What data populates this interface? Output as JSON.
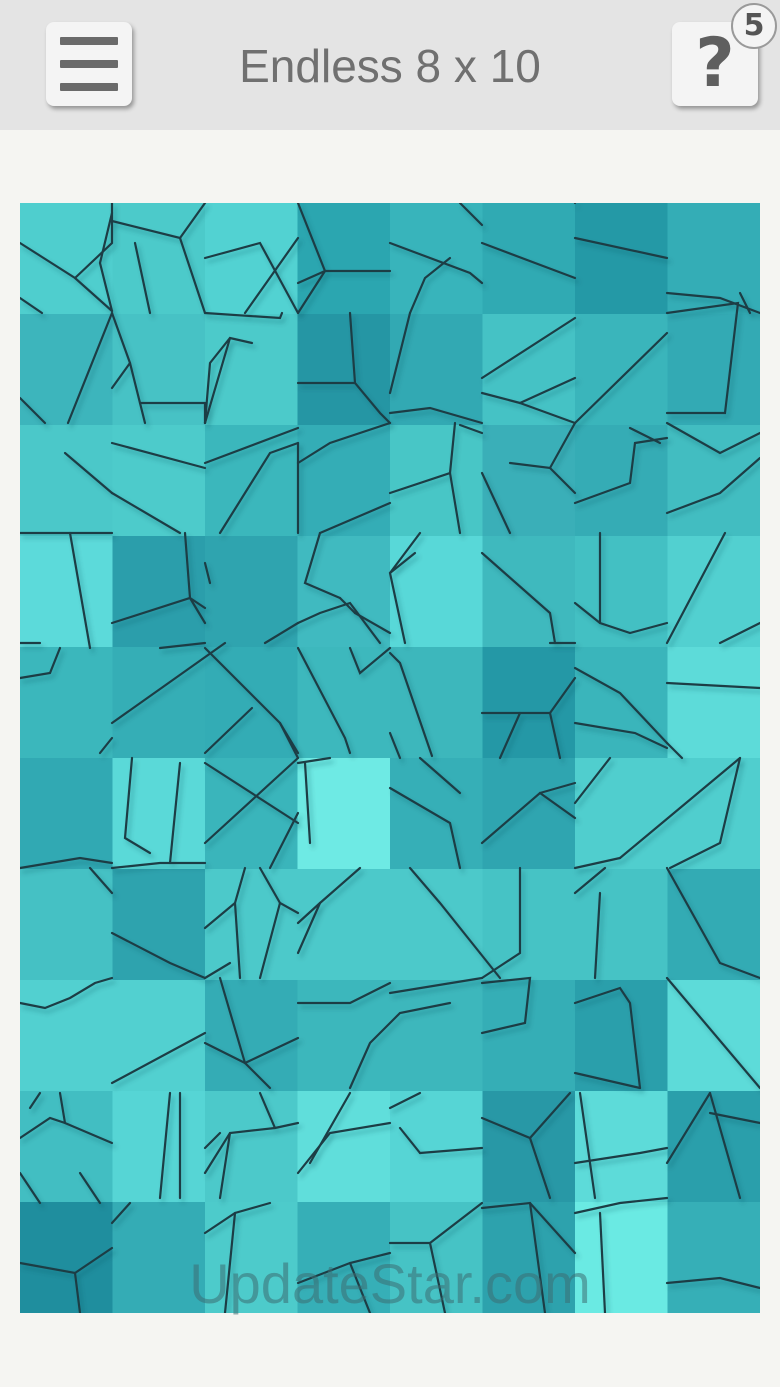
{
  "header": {
    "title": "Endless 8 x 10",
    "menu_icon": "hamburger-menu-icon",
    "help_icon": "question-mark-icon",
    "help_label": "?",
    "help_count": "5"
  },
  "board": {
    "columns": 8,
    "rows": 10,
    "tile_colors": [
      [
        "#4fcece",
        "#4ccaca",
        "#52d2d2",
        "#2ba6b0",
        "#38b4bb",
        "#30aab3",
        "#2499a6",
        "#34adb6"
      ],
      [
        "#3db5bc",
        "#47c2c5",
        "#4ccaca",
        "#2596a4",
        "#32a9b3",
        "#45c2c5",
        "#3ab5bb",
        "#33aab4"
      ],
      [
        "#4bc8c9",
        "#4dcbcb",
        "#3bb7bc",
        "#34adb6",
        "#48c6c6",
        "#3aafb8",
        "#35acb5",
        "#42bdc1"
      ],
      [
        "#5cdada",
        "#2b9eab",
        "#2fa4af",
        "#40bac0",
        "#58d8d8",
        "#3fb9be",
        "#43c0c3",
        "#52d0d0"
      ],
      [
        "#3bb7bc",
        "#35aeb6",
        "#33acb5",
        "#3db8bd",
        "#3db7bc",
        "#2498a6",
        "#3ab5bb",
        "#5ddbd9"
      ],
      [
        "#31a9b3",
        "#5ad9d8",
        "#3ab5bb",
        "#6eeae4",
        "#36afb7",
        "#2fa5b0",
        "#50cece",
        "#50cece"
      ],
      [
        "#45c1c4",
        "#2ea3ae",
        "#4cc9ca",
        "#4cc9ca",
        "#4cc9ca",
        "#46c3c5",
        "#46c3c5",
        "#33abb4"
      ],
      [
        "#52d0d0",
        "#52d0d0",
        "#34acb5",
        "#3cb7bc",
        "#3db7bc",
        "#35aeb6",
        "#2a9fab",
        "#5ddbd9"
      ],
      [
        "#42bec2",
        "#56d5d5",
        "#4cc9ca",
        "#60dedb",
        "#56d5d5",
        "#2898a6",
        "#5ddbd9",
        "#2a9fab"
      ],
      [
        "#1f8e9e",
        "#34acb5",
        "#4dcbcb",
        "#36afb7",
        "#46c3c5",
        "#2da2ad",
        "#6aeae3",
        "#36afb7"
      ]
    ]
  },
  "watermark": "UpdateStar.com"
}
